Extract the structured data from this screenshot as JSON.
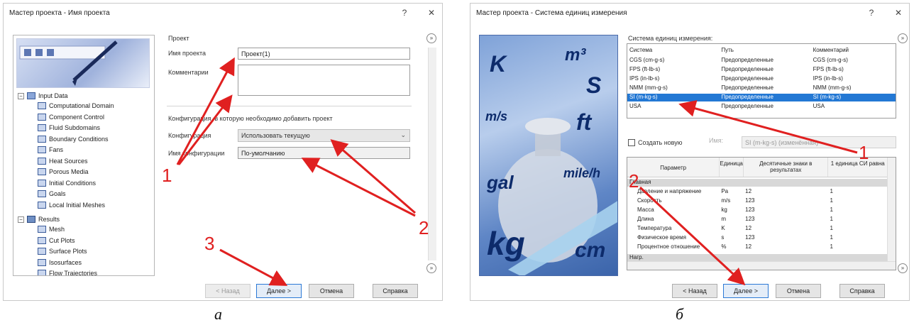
{
  "colors": {
    "arrow": "#e02020",
    "selection": "#2378d4",
    "accent_blue": "#2b79d6"
  },
  "left_window": {
    "title": "Мастер проекта - Имя проекта",
    "help_glyph": "?",
    "close_glyph": "✕",
    "group_project": "Проект",
    "project_name_label": "Имя проекта",
    "project_name_value": "Проект(1)",
    "comment_label": "Комментарии",
    "config_header": "Конфигурация, в которую необходимо добавить проект",
    "config_label": "Конфигурация",
    "config_value": "Использовать текущую",
    "config_name_label": "Имя конфигурации",
    "config_name_value": "По-умолчанию",
    "collapse_glyph": "»",
    "tree": {
      "input_data": "Input Data",
      "items": [
        "Computational Domain",
        "Component Control",
        "Fluid Subdomains",
        "Boundary Conditions",
        "Fans",
        "Heat Sources",
        "Porous Media",
        "Initial Conditions",
        "Goals",
        "Local Initial Meshes"
      ],
      "results": "Results",
      "result_items": [
        "Mesh",
        "Cut Plots",
        "Surface Plots",
        "Isosurfaces",
        "Flow Trajectories"
      ]
    },
    "buttons": {
      "back": "< Назад",
      "next": "Далее >",
      "cancel": "Отмена",
      "help": "Справка"
    }
  },
  "right_window": {
    "title": "Мастер проекта - Система единиц измерения",
    "help_glyph": "?",
    "close_glyph": "✕",
    "units_group": "Система единиц измерения:",
    "systems_header": [
      "Система",
      "Путь",
      "Комментарий"
    ],
    "systems": [
      [
        "CGS (cm-g-s)",
        "Предопределенные",
        "CGS (cm-g-s)"
      ],
      [
        "FPS (ft-lb-s)",
        "Предопределенные",
        "FPS (ft-lb-s)"
      ],
      [
        "IPS (in-lb-s)",
        "Предопределенные",
        "IPS (in-lb-s)"
      ],
      [
        "NMM (mm-g-s)",
        "Предопределенные",
        "NMM (mm-g-s)"
      ],
      [
        "SI (m-kg-s)",
        "Предопределенные",
        "SI (m-kg-s)"
      ],
      [
        "USA",
        "Предопределенные",
        "USA"
      ]
    ],
    "selected_system_index": 4,
    "create_new_label": "Создать новую",
    "name_label": "Имя:",
    "name_value": "SI (m-kg-s) (изменённая)",
    "params_header": [
      "Параметр",
      "Единица",
      "Десятичные знаки в результатах",
      "1 единица СИ равна"
    ],
    "group_main": "Главная",
    "params": [
      [
        "Давление и напряжение",
        "Pa",
        "12",
        "1"
      ],
      [
        "Скорость",
        "m/s",
        "123",
        "1"
      ],
      [
        "Масса",
        "kg",
        "123",
        "1"
      ],
      [
        "Длина",
        "m",
        "123",
        "1"
      ],
      [
        "Температура",
        "K",
        "12",
        "1"
      ],
      [
        "Физическое время",
        "s",
        "123",
        "1"
      ],
      [
        "Процентное отношение",
        "%",
        "12",
        "1"
      ]
    ],
    "group_loads": "Нагр.",
    "image_units": [
      "K",
      "m³",
      "S",
      "m/s",
      "ft",
      "gal",
      "mile/h",
      "kg",
      "cm"
    ],
    "buttons": {
      "back": "< Назад",
      "next": "Далее >",
      "cancel": "Отмена",
      "help": "Справка"
    }
  },
  "annotations": {
    "n1_left": "1",
    "n2_left": "2",
    "n3_left": "3",
    "n1_right": "1",
    "n2_right": "2"
  },
  "captions": {
    "left": "а",
    "right": "б"
  }
}
